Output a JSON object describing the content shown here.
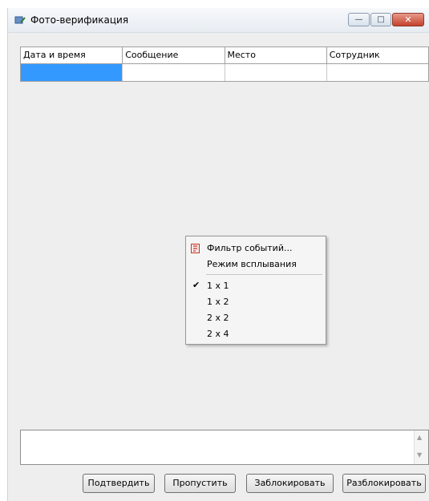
{
  "window": {
    "title": "Фото-верификация",
    "minimize_glyph": "—",
    "maximize_glyph": "□",
    "close_glyph": "✕"
  },
  "grid": {
    "columns": [
      "Дата и время",
      "Сообщение",
      "Место",
      "Сотрудник"
    ]
  },
  "context_menu": {
    "filter_label": "Фильтр событий...",
    "popup_mode_label": "Режим всплывания",
    "layout_1x1": "1 x 1",
    "layout_1x2": "1 x 2",
    "layout_2x2": "2 x 2",
    "layout_2x4": "2 x 4",
    "check_glyph": "✔"
  },
  "message_box": {
    "scroll_up": "▲",
    "scroll_down": "▼"
  },
  "buttons": {
    "confirm": "Подтвердить",
    "skip": "Пропустить",
    "block": "Заблокировать",
    "unblock": "Разблокировать"
  },
  "colors": {
    "selection": "#3399ff",
    "window_bg": "#eeeeee"
  }
}
